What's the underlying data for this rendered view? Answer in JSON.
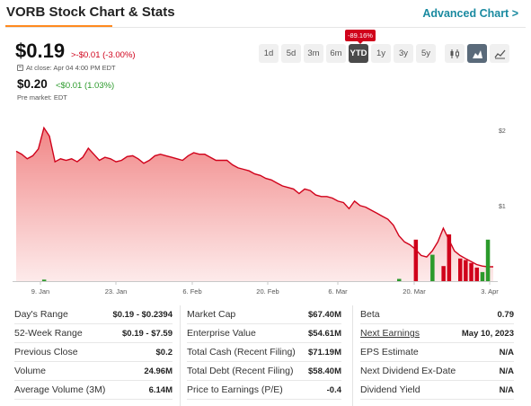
{
  "header": {
    "title": "VORB Stock Chart & Stats",
    "advanced_link": "Advanced Chart >"
  },
  "quote": {
    "price": "$0.19",
    "change": ">-$0.01 (-3.00%)",
    "close_note": "At close: Apr 04 4:00 PM EDT",
    "premarket_price": "$0.20",
    "premarket_change": "<$0.01 (1.03%)",
    "premarket_note": "Pre market: EDT"
  },
  "ranges": {
    "items": [
      "1d",
      "5d",
      "3m",
      "6m",
      "YTD",
      "1y",
      "3y",
      "5y"
    ],
    "active": "YTD",
    "badge": "-89.16%"
  },
  "chart_types": {
    "items": [
      "candlestick-icon",
      "mountain-icon",
      "line-icon"
    ],
    "active": "mountain-icon"
  },
  "colors": {
    "accent_orange": "#ff8a1f",
    "link": "#1a8aa0",
    "down": "#d0021b",
    "up": "#2b9a2b",
    "area_line": "#d0021b",
    "area_fill_top": "#f08080"
  },
  "chart_data": {
    "type": "area",
    "x_tick_labels": [
      "9. Jan",
      "23. Jan",
      "6. Feb",
      "20. Feb",
      "6. Mar",
      "20. Mar",
      "3. Apr"
    ],
    "y_tick_labels": [
      "$2",
      "$1"
    ],
    "ylim": [
      0,
      2.2
    ],
    "series": [
      {
        "values": [
          1.72,
          1.68,
          1.62,
          1.66,
          1.75,
          2.03,
          1.92,
          1.58,
          1.62,
          1.6,
          1.62,
          1.58,
          1.64,
          1.76,
          1.68,
          1.6,
          1.64,
          1.62,
          1.58,
          1.6,
          1.65,
          1.66,
          1.62,
          1.56,
          1.6,
          1.66,
          1.68,
          1.66,
          1.64,
          1.62,
          1.6,
          1.66,
          1.7,
          1.68,
          1.68,
          1.64,
          1.6,
          1.6,
          1.6,
          1.54,
          1.5,
          1.48,
          1.46,
          1.42,
          1.4,
          1.36,
          1.34,
          1.3,
          1.26,
          1.24,
          1.22,
          1.16,
          1.22,
          1.2,
          1.14,
          1.12,
          1.12,
          1.1,
          1.06,
          1.04,
          0.96,
          1.06,
          1.0,
          0.98,
          0.94,
          0.9,
          0.86,
          0.82,
          0.74,
          0.6,
          0.52,
          0.48,
          0.42,
          0.34,
          0.32,
          0.4,
          0.52,
          0.7,
          0.55,
          0.4,
          0.34,
          0.3,
          0.26,
          0.22,
          0.2,
          0.19,
          0.19
        ]
      }
    ],
    "volume": [
      {
        "i": 5,
        "value": 0.02,
        "color": "green"
      },
      {
        "i": 69,
        "value": 0.03,
        "color": "green"
      },
      {
        "i": 72,
        "value": 0.55,
        "color": "red"
      },
      {
        "i": 75,
        "value": 0.35,
        "color": "green"
      },
      {
        "i": 77,
        "value": 0.2,
        "color": "red"
      },
      {
        "i": 78,
        "value": 0.62,
        "color": "red"
      },
      {
        "i": 80,
        "value": 0.3,
        "color": "red"
      },
      {
        "i": 81,
        "value": 0.28,
        "color": "red"
      },
      {
        "i": 82,
        "value": 0.24,
        "color": "red"
      },
      {
        "i": 83,
        "value": 0.18,
        "color": "red"
      },
      {
        "i": 84,
        "value": 0.12,
        "color": "green"
      },
      {
        "i": 85,
        "value": 0.55,
        "color": "green"
      }
    ]
  },
  "stats": {
    "col1": [
      {
        "label": "Day's Range",
        "value": "$0.19 - $0.2394"
      },
      {
        "label": "52-Week Range",
        "value": "$0.19 - $7.59"
      },
      {
        "label": "Previous Close",
        "value": "$0.2"
      },
      {
        "label": "Volume",
        "value": "24.96M"
      },
      {
        "label": "Average Volume (3M)",
        "value": "6.14M"
      }
    ],
    "col2": [
      {
        "label": "Market Cap",
        "value": "$67.40M"
      },
      {
        "label": "Enterprise Value",
        "value": "$54.61M"
      },
      {
        "label": "Total Cash (Recent Filing)",
        "value": "$71.19M"
      },
      {
        "label": "Total Debt (Recent Filing)",
        "value": "$58.40M"
      },
      {
        "label": "Price to Earnings (P/E)",
        "value": "-0.4"
      }
    ],
    "col3": [
      {
        "label": "Beta",
        "value": "0.79"
      },
      {
        "label": "Next Earnings",
        "value": "May 10, 2023"
      },
      {
        "label": "EPS Estimate",
        "value": "N/A"
      },
      {
        "label": "Next Dividend Ex-Date",
        "value": "N/A"
      },
      {
        "label": "Dividend Yield",
        "value": "N/A"
      }
    ]
  }
}
